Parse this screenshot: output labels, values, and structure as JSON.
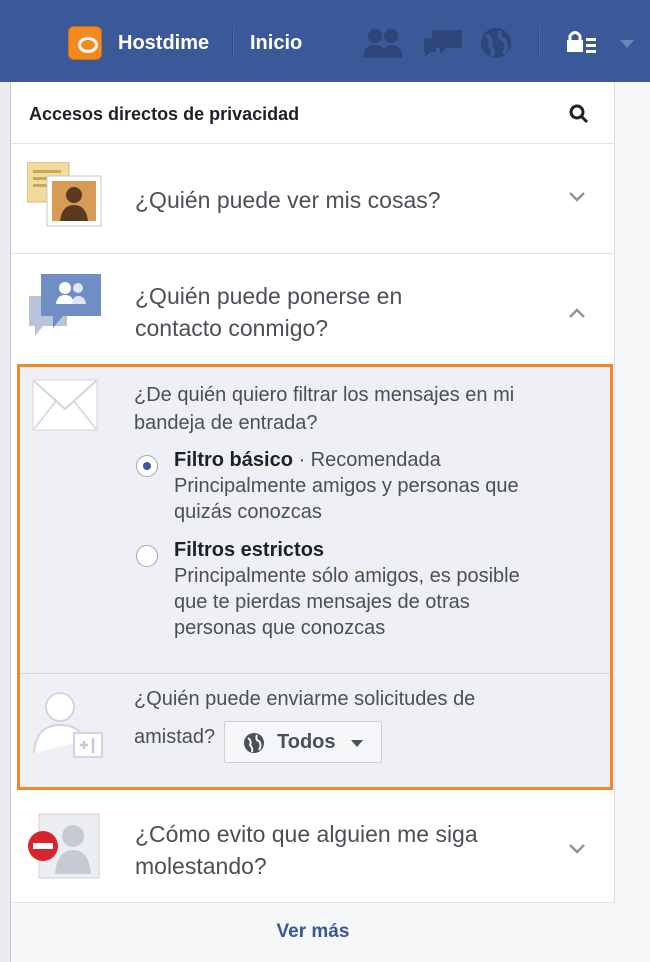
{
  "topbar": {
    "brand_label": "Hostdime",
    "home_label": "Inicio",
    "icons": [
      "friend-requests-icon",
      "messages-icon",
      "notifications-globe-icon",
      "privacy-shortcuts-icon",
      "account-menu-caret-icon"
    ]
  },
  "panel": {
    "title": "Accesos directos de privacidad",
    "search_icon": "search-icon",
    "rows": [
      {
        "label": "¿Quién puede ver mis cosas?",
        "icon": "photo-privacy-icon",
        "state": "collapsed"
      },
      {
        "label_line1": "¿Quién puede ponerse en",
        "label_line2": "contacto conmigo?",
        "icon": "contact-privacy-icon",
        "state": "expanded"
      },
      {
        "label_line1": "¿Cómo evito que alguien me siga",
        "label_line2": "molestando?",
        "icon": "block-user-icon",
        "state": "collapsed"
      }
    ],
    "expanded": {
      "question_line1": "¿De quién quiero filtrar los mensajes en mi",
      "question_line2": "bandeja de entrada?",
      "options": [
        {
          "title": "Filtro básico",
          "suffix": " · Recomendada",
          "desc_line1": "Principalmente amigos y personas que",
          "desc_line2": "quizás conozcas",
          "selected": true
        },
        {
          "title": "Filtros estrictos",
          "desc_line1": "Principalmente sólo amigos, es posible",
          "desc_line2": "que te pierdas mensajes de otras",
          "desc_line3": "personas que conozcas",
          "selected": false
        }
      ],
      "friend_question_line1": "¿Quién puede enviarme solicitudes de",
      "friend_question_line2": "amistad?",
      "audience_value": "Todos"
    },
    "see_more": "Ver más"
  },
  "colors": {
    "topbar": "#3b5998",
    "highlight_border": "#f0872a",
    "link": "#365899"
  }
}
